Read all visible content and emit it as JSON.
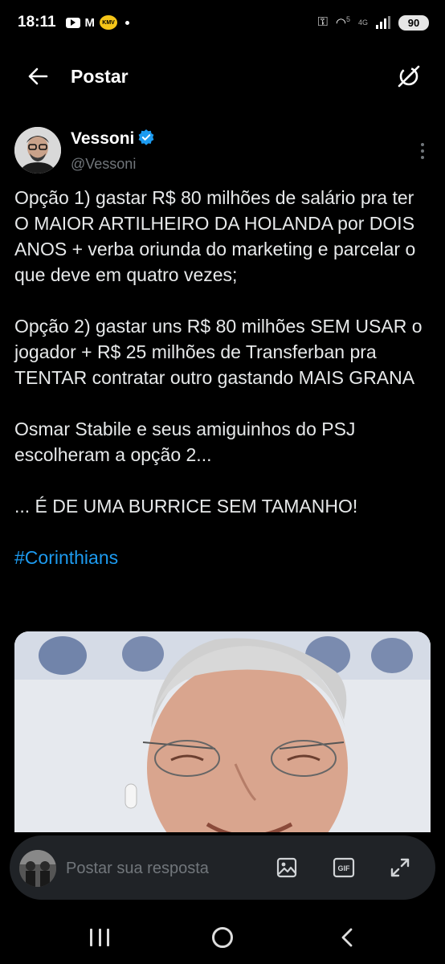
{
  "status_bar": {
    "time": "18:11",
    "kmv_label": "KMV",
    "battery": "90",
    "network": "4G",
    "wifi_badge": "5"
  },
  "header": {
    "title": "Postar"
  },
  "author": {
    "name": "Vessoni",
    "handle": "@Vessoni"
  },
  "tweet": {
    "paragraphs": [
      "Opção 1) gastar R$ 80 milhões de salário pra ter O MAIOR ARTILHEIRO DA HOLANDA por DOIS ANOS + verba oriunda do marketing e parcelar o que deve em quatro vezes;",
      "Opção 2) gastar uns R$ 80 milhões SEM USAR o jogador + R$ 25 milhões de Transferban pra TENTAR  contratar outro gastando MAIS GRANA",
      "Osmar Stabile e seus amiguinhos do PSJ escolheram a opção 2...",
      "... É DE UMA BURRICE SEM TAMANHO!"
    ],
    "hashtag": "#Corinthians"
  },
  "reply_bar": {
    "placeholder": "Postar sua resposta",
    "gif_label": "GIF"
  },
  "colors": {
    "background": "#000000",
    "text": "#e7e9ea",
    "secondary_text": "#71767b",
    "accent": "#1d9bf0",
    "reply_box": "#202327"
  },
  "icons": {
    "back": "arrow-left-icon",
    "grok": "grok-icon",
    "verified": "verified-badge-icon",
    "more": "more-vertical-icon",
    "image": "image-icon",
    "gif": "gif-icon",
    "expand": "expand-icon"
  }
}
